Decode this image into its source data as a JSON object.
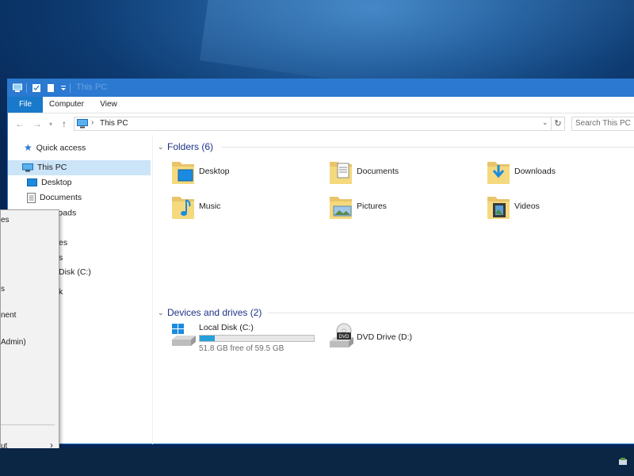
{
  "window": {
    "title": "This PC"
  },
  "ribbon": {
    "tabs": [
      "File",
      "Computer",
      "View"
    ]
  },
  "address": {
    "path_sep": "›",
    "path": "This PC",
    "search_placeholder": "Search This PC"
  },
  "nav": {
    "quick_access": "Quick access",
    "this_pc": "This PC",
    "desktop": "Desktop",
    "documents": "Documents",
    "downloads": "Downloads",
    "partial_1": "es",
    "partial_2": "s",
    "partial_local": "Disk (C:)",
    "partial_3": "k"
  },
  "folders": {
    "header": "Folders (6)",
    "items": [
      "Desktop",
      "Documents",
      "Downloads",
      "Music",
      "Pictures",
      "Videos"
    ]
  },
  "drives": {
    "header": "Devices and drives (2)",
    "local": {
      "name": "Local Disk (C:)",
      "free": "51.8 GB free of 59.5 GB",
      "used_fraction": 0.13
    },
    "dvd": {
      "name": "DVD Drive (D:)",
      "badge": "DVD"
    }
  },
  "context_menu": {
    "items": [
      "es",
      "s",
      "nent",
      "Admin)",
      "ut"
    ]
  },
  "colors": {
    "accent": "#2b79d0",
    "header_text": "#1e3287",
    "selection": "#cce4f7",
    "bar_fill": "#26a0da"
  }
}
